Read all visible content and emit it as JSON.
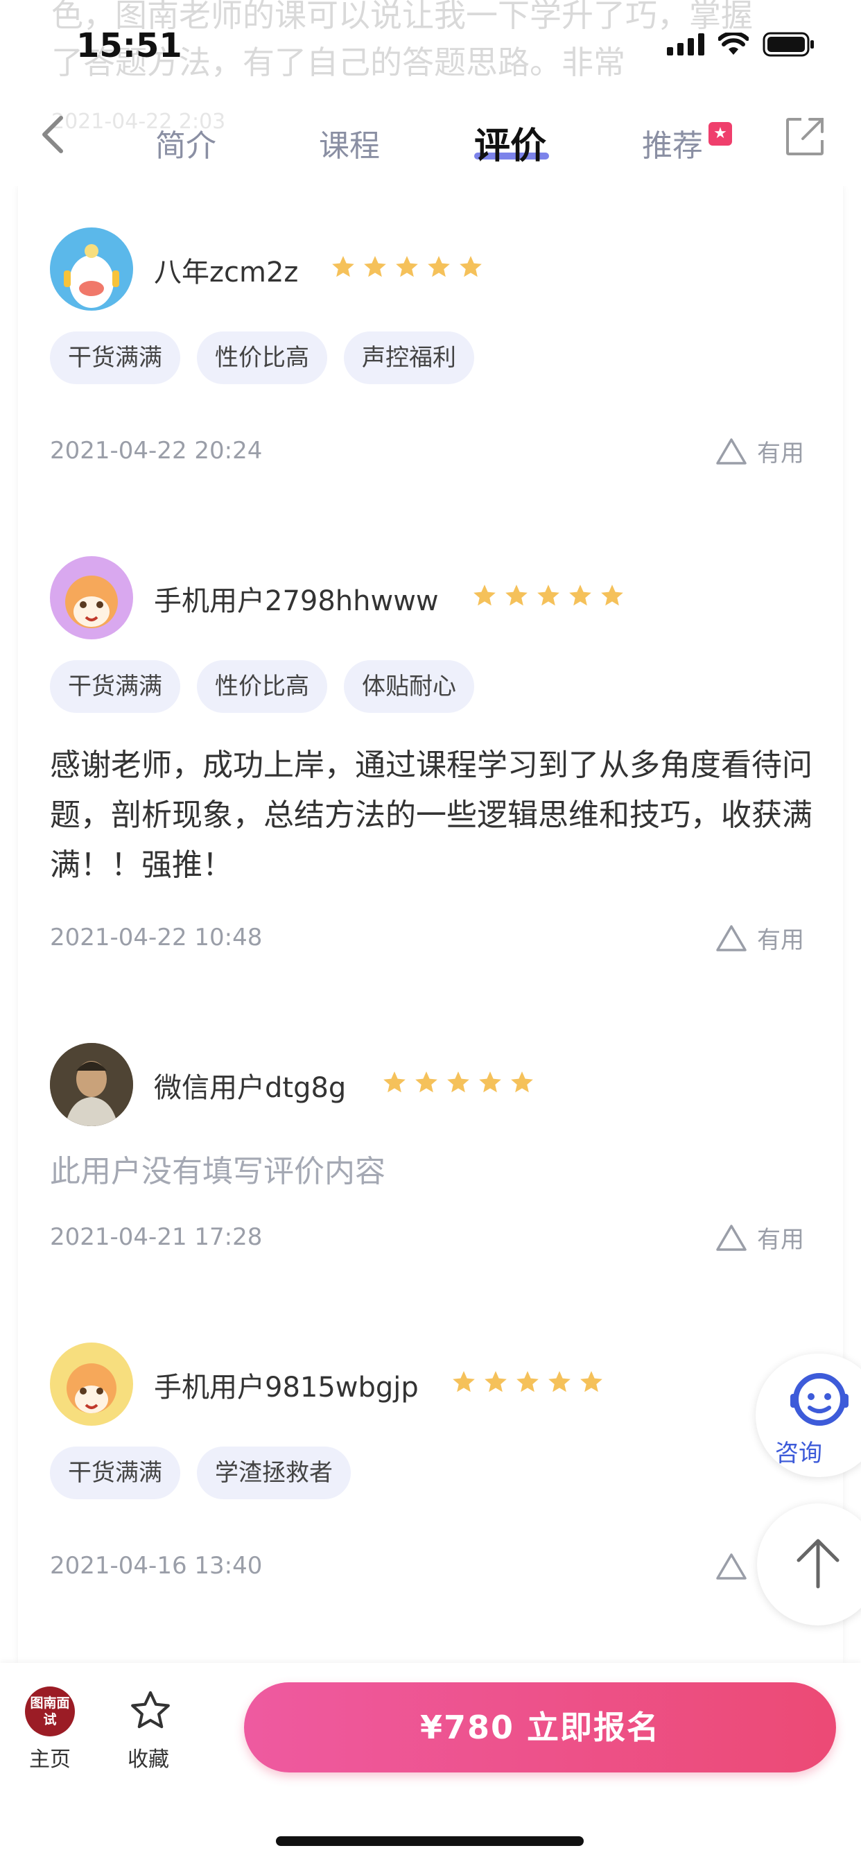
{
  "status": {
    "time": "15:51"
  },
  "background": {
    "line1": "色，图南老师的课可以说让我一下学升了巧，掌握",
    "line2": "了答题方法，有了自己的答题思路。非常",
    "line3": "2021-04-22 2:03"
  },
  "nav": {
    "tabs": [
      {
        "label": "简介",
        "active": false
      },
      {
        "label": "课程",
        "active": false
      },
      {
        "label": "评价",
        "active": true
      },
      {
        "label": "推荐",
        "active": false,
        "badge": true
      }
    ]
  },
  "reviews": [
    {
      "username": "八年zcm2z",
      "rating": 5,
      "tags": [
        "干货满满",
        "性价比高",
        "声控福利"
      ],
      "text": "",
      "date": "2021-04-22 20:24",
      "useful_label": "有用",
      "avatar_color": "#5bb8ea"
    },
    {
      "username": "手机用户2798hhwww",
      "rating": 5,
      "tags": [
        "干货满满",
        "性价比高",
        "体贴耐心"
      ],
      "text": "感谢老师，成功上岸，通过课程学习到了从多角度看待问题，剖析现象，总结方法的一些逻辑思维和技巧，收获满满！！强推！",
      "date": "2021-04-22 10:48",
      "useful_label": "有用",
      "avatar_color": "#d9a8ef"
    },
    {
      "username": "微信用户dtg8g",
      "rating": 5,
      "tags": [],
      "text": "此用户没有填写评价内容",
      "date": "2021-04-21 17:28",
      "useful_label": "有用",
      "avatar_color": "#6b5a43"
    },
    {
      "username": "手机用户9815wbgjp",
      "rating": 5,
      "tags": [
        "干货满满",
        "学渣拯救者"
      ],
      "text": "",
      "date": "2021-04-16 13:40",
      "useful_label": "有用",
      "avatar_color": "#f7de7e"
    }
  ],
  "floating": {
    "consult_label": "咨询"
  },
  "bottom_bar": {
    "home_logo_text": "图南面试",
    "home_label": "主页",
    "fav_label": "收藏",
    "cta_label": "¥780 立即报名"
  },
  "colors": {
    "accent": "#7c83ea",
    "star": "#f5c15a",
    "cta_start": "#ee5aa0",
    "cta_end": "#ec4a75",
    "consult": "#3d5bd9"
  }
}
